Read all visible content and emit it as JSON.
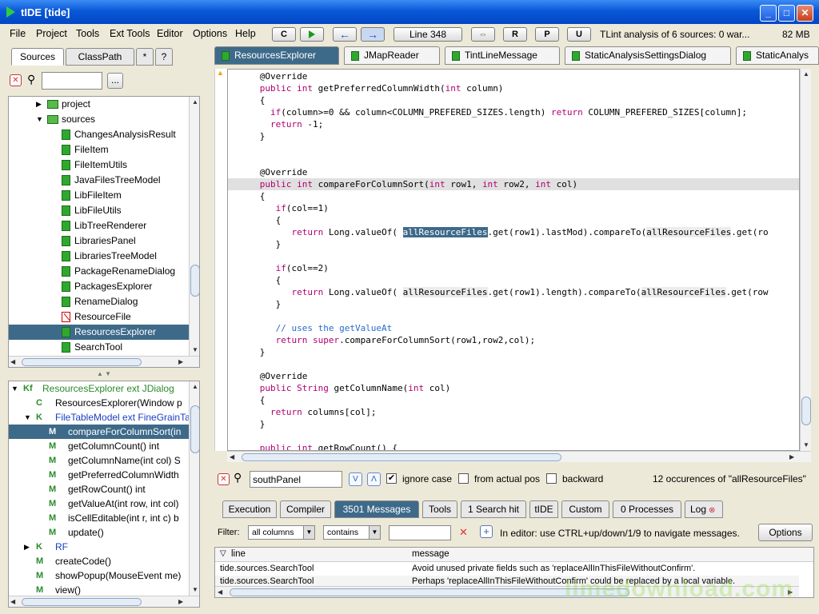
{
  "window": {
    "title": "tIDE [tide]"
  },
  "menu": [
    "File",
    "Project",
    "Tools",
    "Ext Tools",
    "Editor",
    "Options",
    "Help"
  ],
  "toolbar": {
    "c_label": "C",
    "back_icon": "←",
    "forward_icon": "→",
    "line_label": "Line 348",
    "swap_icon": "⇔",
    "r_label": "R",
    "p_label": "P",
    "u_label": "U",
    "status": "TLint analysis of 6 sources: 0 war...",
    "memory": "82 MB"
  },
  "left_tabs": [
    "Sources",
    "ClassPath",
    "*",
    "?"
  ],
  "left_search": {
    "value": "",
    "browse_label": "..."
  },
  "source_tree": [
    {
      "label": "project",
      "indent": 1,
      "expander": "▶",
      "icon": "folder"
    },
    {
      "label": "sources",
      "indent": 1,
      "expander": "▼",
      "icon": "folder"
    },
    {
      "label": "ChangesAnalysisResult",
      "indent": 2,
      "icon": "file"
    },
    {
      "label": "FileItem",
      "indent": 2,
      "icon": "file"
    },
    {
      "label": "FileItemUtils",
      "indent": 2,
      "icon": "file"
    },
    {
      "label": "JavaFilesTreeModel",
      "indent": 2,
      "icon": "file"
    },
    {
      "label": "LibFileItem",
      "indent": 2,
      "icon": "file"
    },
    {
      "label": "LibFileUtils",
      "indent": 2,
      "icon": "file"
    },
    {
      "label": "LibTreeRenderer",
      "indent": 2,
      "icon": "file"
    },
    {
      "label": "LibrariesPanel",
      "indent": 2,
      "icon": "file"
    },
    {
      "label": "LibrariesTreeModel",
      "indent": 2,
      "icon": "file"
    },
    {
      "label": "PackageRenameDialog",
      "indent": 2,
      "icon": "file"
    },
    {
      "label": "PackagesExplorer",
      "indent": 2,
      "icon": "file"
    },
    {
      "label": "RenameDialog",
      "indent": 2,
      "icon": "file"
    },
    {
      "label": "ResourceFile",
      "indent": 2,
      "icon": "err"
    },
    {
      "label": "ResourcesExplorer",
      "indent": 2,
      "icon": "file",
      "selected": true
    },
    {
      "label": "SearchTool",
      "indent": 2,
      "icon": "file"
    }
  ],
  "outline": [
    {
      "badge": "Kf",
      "label": "ResourcesExplorer ext JDialog",
      "indent": 0,
      "expander": "▼",
      "color": "#2a8a2a"
    },
    {
      "badge": "C",
      "label": "ResourcesExplorer(Window p",
      "indent": 1,
      "color": "#000"
    },
    {
      "badge": "K",
      "label": "FileTableModel ext FineGrainTa",
      "indent": 1,
      "expander": "▼",
      "color": "#1a3fc0"
    },
    {
      "badge": "M",
      "label": "compareForColumnSort(in",
      "indent": 2,
      "selected": true
    },
    {
      "badge": "M",
      "label": "getColumnCount() int",
      "indent": 2
    },
    {
      "badge": "M",
      "label": "getColumnName(int col) S",
      "indent": 2
    },
    {
      "badge": "M",
      "label": "getPreferredColumnWidth",
      "indent": 2
    },
    {
      "badge": "M",
      "label": "getRowCount() int",
      "indent": 2
    },
    {
      "badge": "M",
      "label": "getValueAt(int row, int col)",
      "indent": 2
    },
    {
      "badge": "M",
      "label": "isCellEditable(int r, int c) b",
      "indent": 2
    },
    {
      "badge": "M",
      "label": "update()",
      "indent": 2
    },
    {
      "badge": "K",
      "label": "RF",
      "indent": 1,
      "expander": "▶",
      "color": "#1a3fc0"
    },
    {
      "badge": "M",
      "label": "createCode()",
      "indent": 1
    },
    {
      "badge": "M",
      "label": "showPopup(MouseEvent me)",
      "indent": 1
    },
    {
      "badge": "M",
      "label": "view()",
      "indent": 1
    }
  ],
  "editor_tabs": [
    "ResourcesExplorer",
    "JMapReader",
    "TintLineMessage",
    "StaticAnalysisSettingsDialog",
    "StaticAnalys"
  ],
  "code_lines": [
    "      @Override",
    "      public int getPreferredColumnWidth(int column)",
    "      {",
    "        if(column>=0 && column<COLUMN_PREFERED_SIZES.length) return COLUMN_PREFERED_SIZES[column];",
    "        return -1;",
    "      }",
    "",
    "",
    "      @Override",
    "      public int compareForColumnSort(int row1, int row2, int col)",
    "      {",
    "         if(col==1)",
    "         {",
    "            return Long.valueOf( allResourceFiles.get(row1).lastMod).compareTo(allResourceFiles.get(ro",
    "         }",
    "",
    "         if(col==2)",
    "         {",
    "            return Long.valueOf( allResourceFiles.get(row1).length).compareTo(allResourceFiles.get(row",
    "         }",
    "",
    "         // uses the getValueAt",
    "         return super.compareForColumnSort(row1,row2,col);",
    "      }",
    "",
    "      @Override",
    "      public String getColumnName(int col)",
    "      {",
    "        return columns[col];",
    "      }",
    "",
    "      public int getRowCount() {"
  ],
  "find_bar": {
    "value": "southPanel",
    "down_icon": "V",
    "up_icon": "Λ",
    "ignore_case_label": "ignore case",
    "ignore_case_checked": "✔",
    "from_actual_pos_label": "from actual pos",
    "backward_label": "backward",
    "result": "12 occurences of \"allResourceFiles\""
  },
  "bottom_tabs": [
    "Execution",
    "Compiler",
    "3501 Messages",
    "Tools",
    "1 Search hit",
    "tIDE",
    "Custom",
    "0 Processes",
    "Log"
  ],
  "filter": {
    "label": "Filter:",
    "column_combo": "all columns",
    "mode_combo": "contains",
    "value": "",
    "hint": "In editor: use CTRL+up/down/1/9 to navigate messages.",
    "options_label": "Options"
  },
  "messages": {
    "columns": [
      "line",
      "message"
    ],
    "rows": [
      [
        "tide.sources.SearchTool",
        "Avoid unused private fields such as 'replaceAllInThisFileWithoutConfirm'."
      ],
      [
        "tide.sources.SearchTool",
        "Perhaps 'replaceAllInThisFileWithoutConfirm' could be replaced by a local variable."
      ]
    ]
  },
  "watermark": "limedownload.com"
}
